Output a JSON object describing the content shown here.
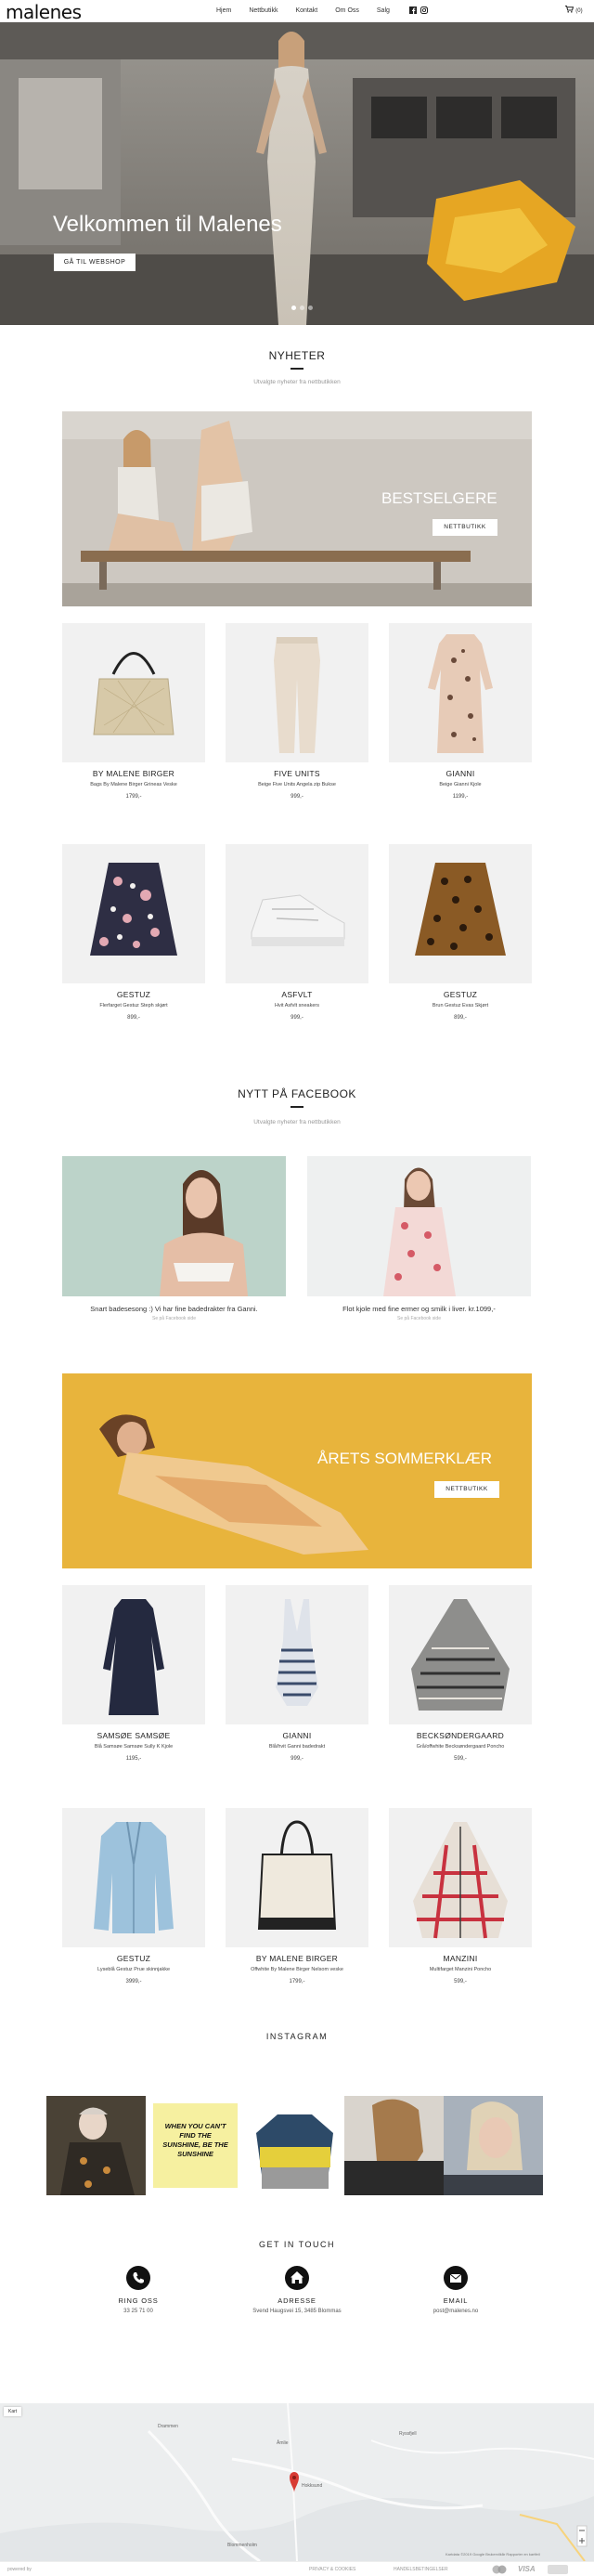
{
  "header": {
    "logo": "malenes",
    "nav": [
      "Hjem",
      "Nettbutikk",
      "Kontakt",
      "Om Oss",
      "Salg"
    ],
    "cart_label": "(0)",
    "icons": [
      "facebook-icon",
      "instagram-icon",
      "cart-icon"
    ]
  },
  "hero": {
    "title": "Velkommen til Malenes",
    "button": "GÅ TIL WEBSHOP",
    "slides": 3
  },
  "news": {
    "title": "NYHETER",
    "subtitle": "Utvalgte nyheter fra nettbutikken"
  },
  "banner1": {
    "title": "BESTSELGERE",
    "button": "NETTBUTIKK"
  },
  "products_a": [
    {
      "brand": "BY MALENE BIRGER",
      "name": "Bags By Malene Birger Grineas Veske",
      "price": "1799,-"
    },
    {
      "brand": "FIVE UNITS",
      "name": "Beige Five Units Angela zip Bukse",
      "price": "999,-"
    },
    {
      "brand": "GIANNI",
      "name": "Beige Gianni Kjole",
      "price": "1199,-"
    },
    {
      "brand": "GESTUZ",
      "name": "Flerfarget Gestuz Steph skjørt",
      "price": "899,-"
    },
    {
      "brand": "ASFVLT",
      "name": "Hvit Asfvlt sneakers",
      "price": "999,-"
    },
    {
      "brand": "GESTUZ",
      "name": "Brun Gestuz Evas Skjørt",
      "price": "899,-"
    }
  ],
  "facebook": {
    "title": "NYTT PÅ FACEBOOK",
    "subtitle": "Utvalgte nyheter fra nettbutikken",
    "posts": [
      {
        "text": "Snart badesesong :) Vi har fine badedrakter fra Ganni.",
        "via": "Se på Facebook side"
      },
      {
        "text": "Flot kjole med fine ermer og smilk i liver. kr.1099,-",
        "via": "Se på Facebook side"
      }
    ]
  },
  "banner2": {
    "title": "ÅRETS SOMMERKLÆR",
    "button": "NETTBUTIKK"
  },
  "products_b": [
    {
      "brand": "SAMSØE SAMSØE",
      "name": "Blå Samsøe Samsøe Sully K Kjole",
      "price": "1195,-"
    },
    {
      "brand": "GIANNI",
      "name": "Blå/hvit Ganni badedrakt",
      "price": "999,-"
    },
    {
      "brand": "BECKSØNDERGAARD",
      "name": "Grå/offwhite Becksøndergaard Poncho",
      "price": "599,-"
    },
    {
      "brand": "GESTUZ",
      "name": "Lyseblå Gestuz Prue skinnjakke",
      "price": "3999,-"
    },
    {
      "brand": "BY MALENE BIRGER",
      "name": "Offwhite By Malene Birger Nelsom veske",
      "price": "1799,-"
    },
    {
      "brand": "MANZINI",
      "name": "Multifarget Manzini Poncho",
      "price": "599,-"
    }
  ],
  "instagram": {
    "title": "INSTAGRAM",
    "quote": "WHEN YOU CAN'T FIND THE SUNSHINE, BE THE SUNSHINE"
  },
  "contact": {
    "title": "GET IN TOUCH",
    "items": [
      {
        "title": "RING OSS",
        "value": "33 25 71 00",
        "icon": "phone-icon"
      },
      {
        "title": "ADRESSE",
        "value": "Svend Haugsvei 15, 3485 Blommas",
        "icon": "home-icon"
      },
      {
        "title": "EMAIL",
        "value": "post@malenes.no",
        "icon": "email-icon"
      }
    ]
  },
  "map": {
    "labels": [
      "Kart",
      "Drammen",
      "Åmlie",
      "Hokksund",
      "Ryssfjell",
      "Blommenholm"
    ],
    "attribution": "Kartdata ©2019 Google   Brukervilkår   Rapporter en kartfeil"
  },
  "footer": {
    "left": "powered by",
    "center": "PRIVACY & COOKIES",
    "center2": "HANDELSBETINGELSER",
    "payments": [
      "VISA"
    ]
  },
  "colors": {
    "banner1_bg": "#cfcac3",
    "banner2_bg": "#e8b43c",
    "dark": "#111111"
  }
}
